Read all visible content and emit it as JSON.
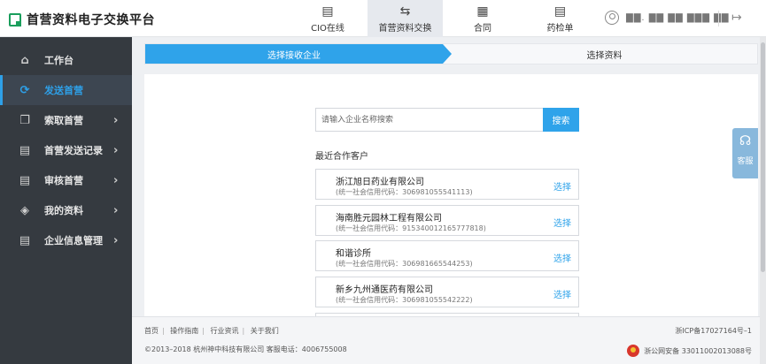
{
  "app": {
    "title": "首营资料电子交换平台"
  },
  "nav": [
    {
      "label": "CIO在线",
      "icon": "document-icon"
    },
    {
      "label": "首营资料交换",
      "icon": "exchange-icon"
    },
    {
      "label": "合同",
      "icon": "contract-icon"
    },
    {
      "label": "药检单",
      "icon": "report-icon"
    }
  ],
  "user": {
    "name": "▇▇. ▇▇ ▇▇ ▇▇▇ ▇▇"
  },
  "sidebar": {
    "items": [
      {
        "label": "工作台"
      },
      {
        "label": "发送首营"
      },
      {
        "label": "索取首营"
      },
      {
        "label": "首营发送记录"
      },
      {
        "label": "审核首营"
      },
      {
        "label": "我的资料"
      },
      {
        "label": "企业信息管理"
      }
    ]
  },
  "steps": {
    "step1": "选择接收企业",
    "step2": "选择资料"
  },
  "search": {
    "placeholder": "请输入企业名称搜索",
    "button": "搜索"
  },
  "recent": {
    "title": "最近合作客户",
    "select_label": "选择",
    "customers": [
      {
        "name": "浙江旭日药业有限公司",
        "code": "(统一社会信用代码：306981055541113)"
      },
      {
        "name": "海南胜元园林工程有限公司",
        "code": "(统一社会信用代码：91534001216577781​8)"
      },
      {
        "name": "和谐诊所",
        "code": "(统一社会信用代码：306981665544253)"
      },
      {
        "name": "新乡九州通医药有限公司",
        "code": "(统一社会信用代码：306981055542222)"
      }
    ]
  },
  "footer": {
    "links": [
      "首页",
      "操作指南",
      "行业资讯",
      "关于我们"
    ],
    "copyright": "©2013–2018   杭州神中科技有限公司   客服电话：4006755008",
    "icp": "浙ICP备17027164号–1",
    "police": "浙公网安备 33011002013088号"
  },
  "service": {
    "label": "客服"
  },
  "colors": {
    "accent": "#2fa3ea",
    "sidebar_bg": "#353a40",
    "logo_green": "#1a9e5c"
  }
}
